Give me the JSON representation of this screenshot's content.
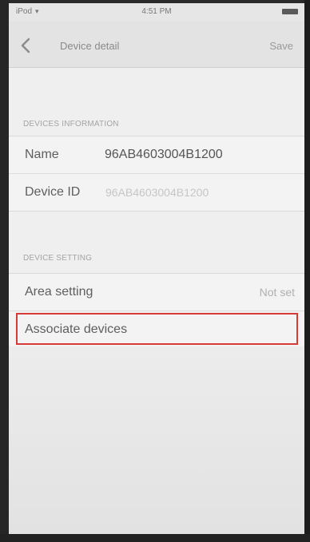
{
  "status_bar": {
    "carrier": "iPod",
    "time": "4:51 PM"
  },
  "nav": {
    "back_icon": "chevron-left-icon",
    "title": "Device detail",
    "save_label": "Save"
  },
  "devices_information": {
    "header": "DEVICES INFORMATION",
    "rows": [
      {
        "label": "Name",
        "value": "96AB4603004B1200"
      },
      {
        "label": "Device ID",
        "value": "96AB4603004B1200"
      }
    ]
  },
  "device_setting": {
    "header": "DEVICE SETTING",
    "rows": [
      {
        "label": "Area setting",
        "detail": "Not set"
      },
      {
        "label": "Associate devices"
      }
    ]
  },
  "colors": {
    "highlight": "#d83a3a",
    "background": "#efefef"
  }
}
